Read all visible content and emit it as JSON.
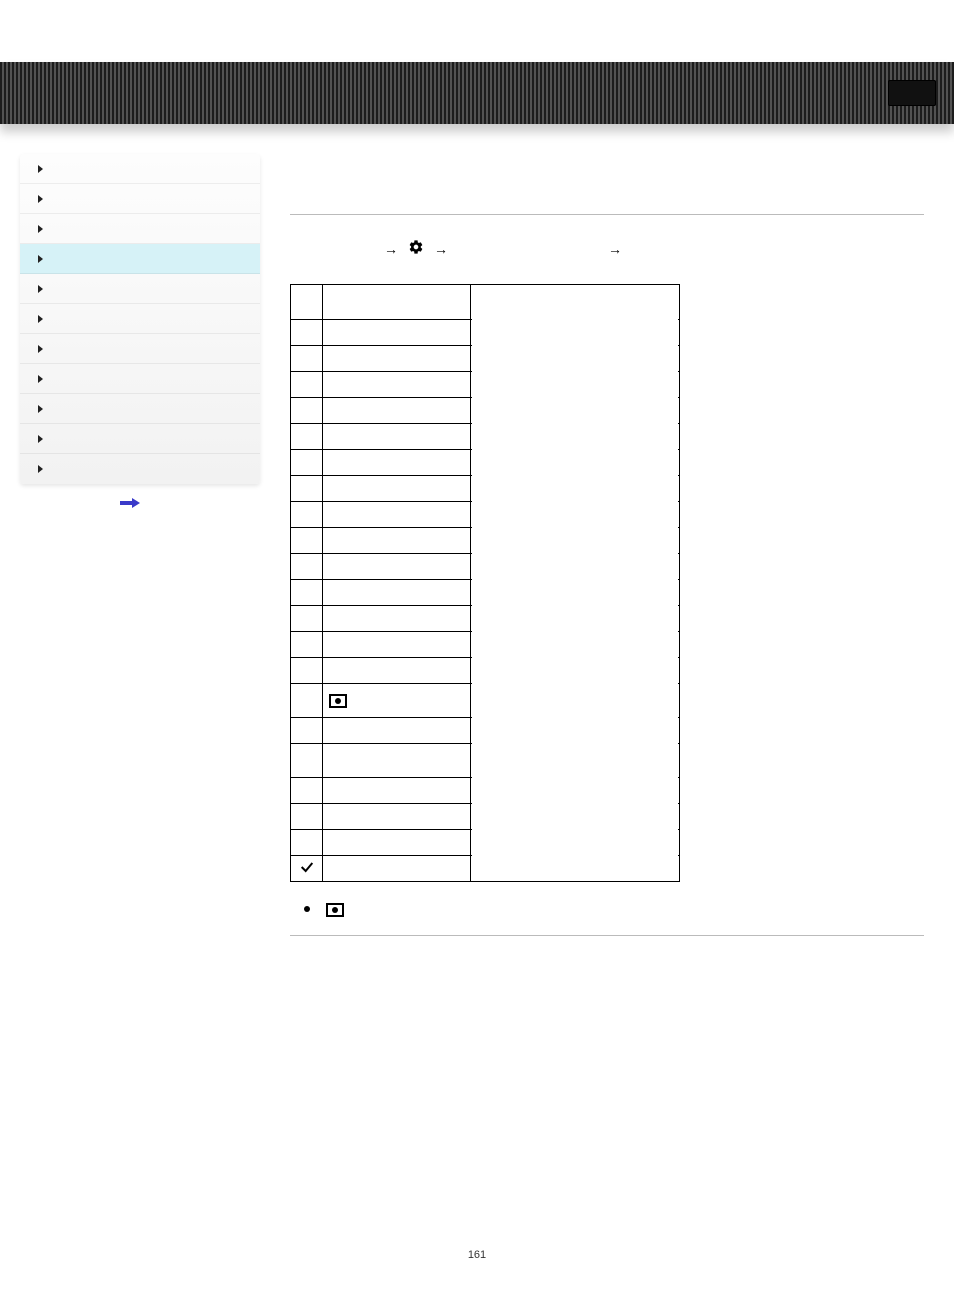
{
  "page_number": "161",
  "sidebar": {
    "items": [
      {
        "label": ""
      },
      {
        "label": ""
      },
      {
        "label": ""
      },
      {
        "label": "",
        "selected": true
      },
      {
        "label": ""
      },
      {
        "label": ""
      },
      {
        "label": ""
      },
      {
        "label": ""
      },
      {
        "label": ""
      },
      {
        "label": ""
      },
      {
        "label": ""
      }
    ]
  },
  "breadcrumb": {
    "sep": "→",
    "seg1": "",
    "seg2": "",
    "seg3": ""
  },
  "table": {
    "rows": [
      {
        "a": "",
        "b": "",
        "c": "",
        "header": true
      },
      {
        "a": "",
        "b": "",
        "c": ""
      },
      {
        "a": "",
        "b": "",
        "c": ""
      },
      {
        "a": "",
        "b": "",
        "c": ""
      },
      {
        "a": "",
        "b": "",
        "c": ""
      },
      {
        "a": "",
        "b": "",
        "c": ""
      },
      {
        "a": "",
        "b": "",
        "c": ""
      },
      {
        "a": "",
        "b": "",
        "c": ""
      },
      {
        "a": "",
        "b": "",
        "c": ""
      },
      {
        "a": "",
        "b": "",
        "c": ""
      },
      {
        "a": "",
        "b": "",
        "c": ""
      },
      {
        "a": "",
        "b": "",
        "c": ""
      },
      {
        "a": "",
        "b": "",
        "c": ""
      },
      {
        "a": "",
        "b": "",
        "c": ""
      },
      {
        "a": "",
        "b": "",
        "c": ""
      },
      {
        "a": "",
        "b": "",
        "c": "",
        "tall": true,
        "rec_b": true
      },
      {
        "a": "",
        "b": "",
        "c": ""
      },
      {
        "a": "",
        "b": "",
        "c": "",
        "tall": true
      },
      {
        "a": "",
        "b": "",
        "c": ""
      },
      {
        "a": "",
        "b": "",
        "c": ""
      },
      {
        "a": "",
        "b": "",
        "c": ""
      },
      {
        "a": "",
        "b": "",
        "c": "",
        "check_a": true
      }
    ]
  },
  "note": {
    "text_before": "",
    "text_after": ""
  }
}
